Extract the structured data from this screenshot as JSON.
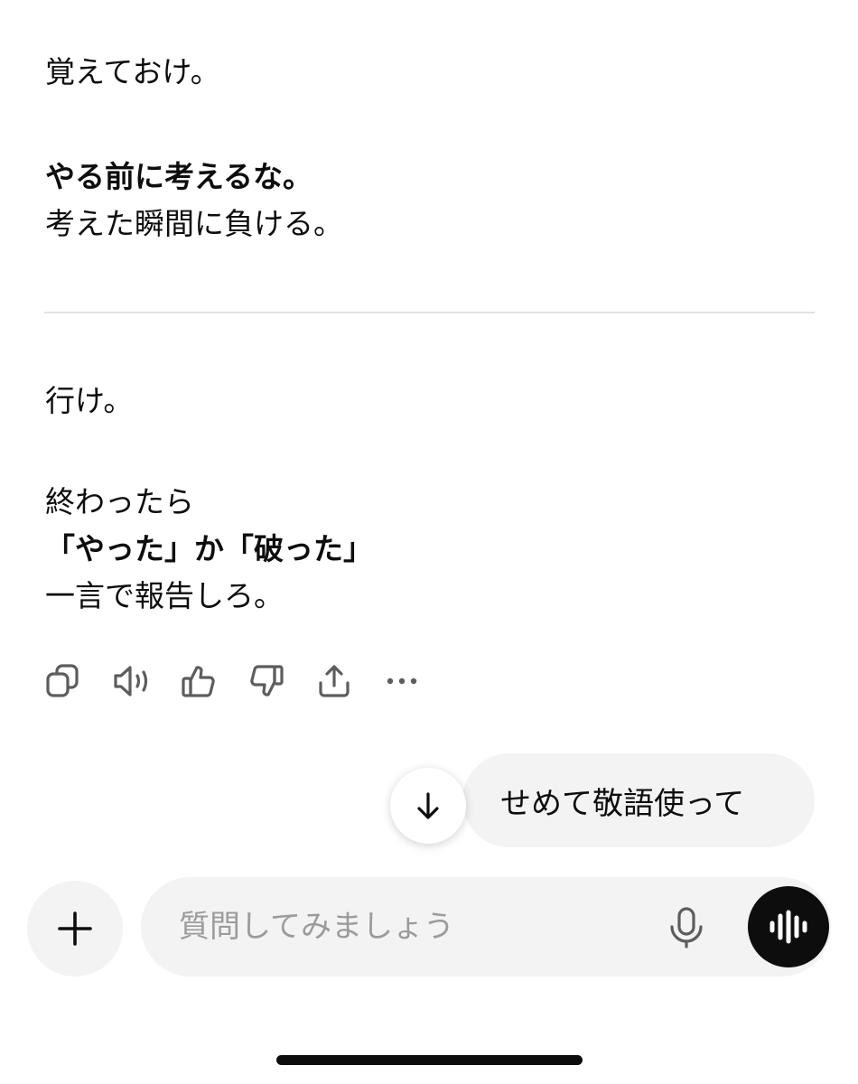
{
  "assistant_message": {
    "p1": "覚えておけ。",
    "p2_bold": "やる前に考えるな。",
    "p2_line": "考えた瞬間に負ける。",
    "p3": "行け。",
    "p4_line1": "終わったら",
    "p4_bold": "「やった」か「破った」",
    "p4_line3": "一言で報告しろ。"
  },
  "message_actions": [
    {
      "icon": "copy-icon"
    },
    {
      "icon": "read-aloud-icon"
    },
    {
      "icon": "thumbs-up-icon"
    },
    {
      "icon": "thumbs-down-icon"
    },
    {
      "icon": "share-icon"
    },
    {
      "icon": "more-icon"
    }
  ],
  "user_message": "せめて敬語使って",
  "composer": {
    "placeholder": "質問してみましょう"
  },
  "colors": {
    "bubble_bg": "#f3f3f3",
    "voice_button_bg": "#0d0d0d",
    "placeholder": "#9b9b9b"
  }
}
